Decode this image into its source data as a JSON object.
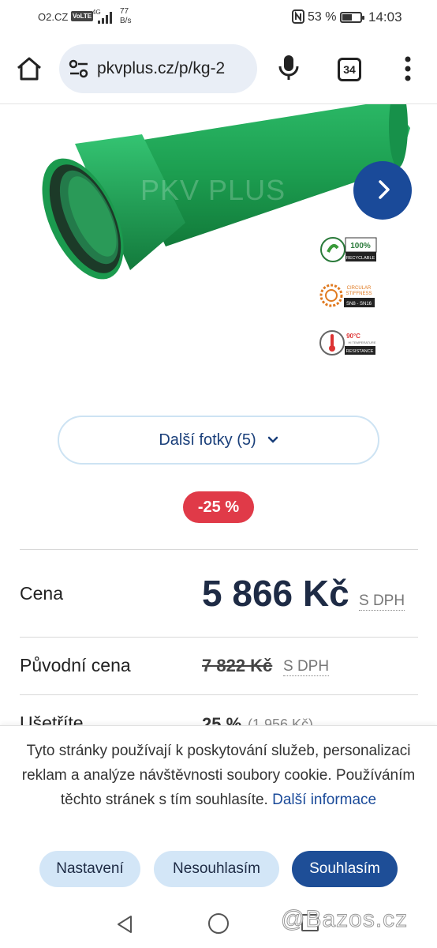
{
  "status_bar": {
    "carrier": "O2.CZ",
    "volte": "VoLTE",
    "network": "4G",
    "speed_value": "77",
    "speed_unit": "B/s",
    "battery_percent": "53 %",
    "battery_level": 0.53,
    "time": "14:03"
  },
  "browser": {
    "url": "pkvplus.cz/p/kg-2",
    "tab_count": "34",
    "icons": [
      "home-icon",
      "site-settings-icon",
      "microphone-icon",
      "tabs-icon",
      "more-vert-icon"
    ]
  },
  "product": {
    "watermark": "PKV PLUS",
    "badges": [
      {
        "line1": "100%",
        "line2": "RECYCLABLE",
        "icon": "recycle-icon"
      },
      {
        "line1": "CIRCULAR",
        "line1b": "STIFFNESS",
        "line2": "SN8 - SN16",
        "icon": "stiffness-icon"
      },
      {
        "line1": "90°C",
        "line1b": "HI TEMPERATURE",
        "line2": "RESISTANCE",
        "icon": "thermometer-icon"
      }
    ],
    "more_photos_label": "Další fotky (5)",
    "discount_badge": "-25 %"
  },
  "pricing": {
    "price_label": "Cena",
    "price_value": "5 866 Kč",
    "vat_label": "S DPH",
    "original_label": "Původní cena",
    "original_value": "7 822 Kč",
    "original_vat": "S DPH",
    "saving_label": "Ušetříte",
    "saving_percent": "25 %",
    "saving_amount": "(1 956 Kč)"
  },
  "cookie_banner": {
    "message": "Tyto stránky používají k poskytování služeb, personalizaci reklam a analýze návštěvnosti soubory cookie. Používáním těchto stránek s tím souhlasíte.",
    "link_text": "Další informace",
    "settings_button": "Nastavení",
    "decline_button": "Nesouhlasím",
    "accept_button": "Souhlasím"
  },
  "overlay_watermark": "@Bazos.cz",
  "colors": {
    "brand_blue": "#1a4a99",
    "pipe_green": "#1fa050",
    "discount_red": "#e03a48"
  }
}
